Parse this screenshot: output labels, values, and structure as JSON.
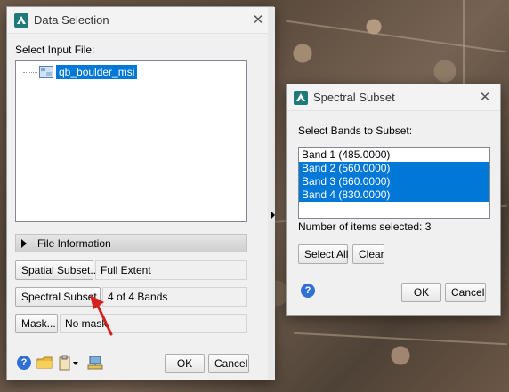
{
  "data_selection": {
    "title": "Data Selection",
    "select_input_label": "Select Input File:",
    "tree_items": [
      {
        "label": "qb_boulder_msi",
        "selected": true
      }
    ],
    "file_information_label": "File Information",
    "spatial_subset_button": "Spatial Subset...",
    "spatial_subset_value": "Full Extent",
    "spectral_subset_button": "Spectral Subset...",
    "spectral_subset_value": "4 of 4 Bands",
    "mask_button": "Mask...",
    "mask_value": "No mask",
    "ok_button": "OK",
    "cancel_button": "Cancel",
    "toolbar_icons": [
      "help-icon",
      "open-folder-icon",
      "clipboard-dropdown-icon",
      "network-icon"
    ]
  },
  "spectral_subset": {
    "title": "Spectral Subset",
    "select_bands_label": "Select Bands to Subset:",
    "bands": [
      {
        "label": "Band 1 (485.0000)",
        "selected": false
      },
      {
        "label": "Band 2 (560.0000)",
        "selected": true
      },
      {
        "label": "Band 3 (660.0000)",
        "selected": true
      },
      {
        "label": "Band 4 (830.0000)",
        "selected": true
      }
    ],
    "items_selected_text": "Number of items selected: 3",
    "select_all_button": "Select All",
    "clear_button": "Clear",
    "ok_button": "OK",
    "cancel_button": "Cancel"
  },
  "colors": {
    "selection_blue": "#0078d7",
    "annotation_arrow": "#d62020",
    "dialog_bg": "#f0f0f0"
  }
}
